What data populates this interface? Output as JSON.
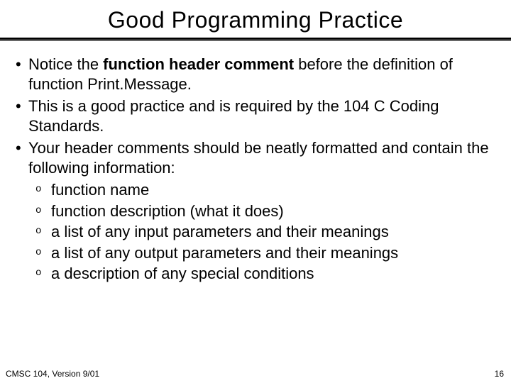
{
  "title": "Good Programming Practice",
  "bullets": {
    "b1": {
      "pre": "Notice the ",
      "bold": "function header comment",
      "post": " before the definition of function Print.Message."
    },
    "b2": "This is a good practice and is required by the 104 C Coding Standards.",
    "b3": "Your header comments should be neatly formatted and contain the following information:",
    "s1": "function name",
    "s2": "function description (what it does)",
    "s3": "a list of any input parameters and their meanings",
    "s4": "a list of any output parameters and their meanings",
    "s5": "a description of any special conditions"
  },
  "footer": {
    "left": "CMSC 104, Version 9/01",
    "right": "16"
  },
  "glyphs": {
    "dot": "•",
    "sub": "o"
  }
}
